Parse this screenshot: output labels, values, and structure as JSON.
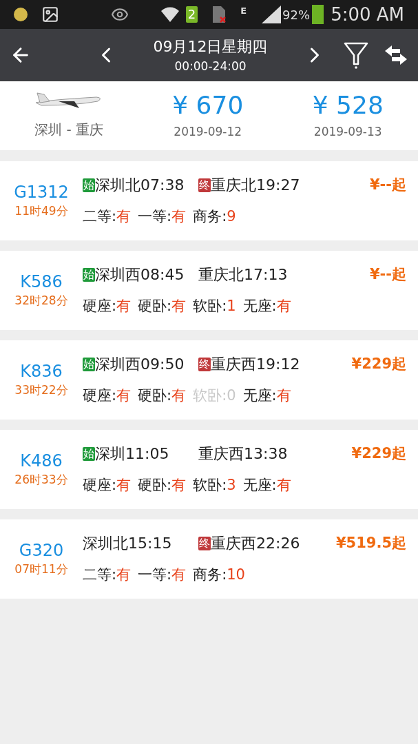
{
  "status_bar": {
    "sim_slot": "2",
    "network_type": "E",
    "battery": "92%",
    "time": "5:00 AM"
  },
  "header": {
    "date": "09月12日星期四",
    "time_range": "00:00-24:00"
  },
  "flight": {
    "route": "深圳 - 重庆",
    "fares": [
      {
        "price": "¥ 670",
        "date": "2019-09-12"
      },
      {
        "price": "¥ 528",
        "date": "2019-09-13"
      }
    ]
  },
  "trains": [
    {
      "number": "G1312",
      "duration": "11时49分",
      "departure": {
        "badge": "始",
        "station": "深圳北07:38"
      },
      "arrival": {
        "badge": "终",
        "station": "重庆北19:27"
      },
      "price": "¥--起",
      "seats": [
        {
          "label": "二等:",
          "value": "有",
          "available": true
        },
        {
          "label": "一等:",
          "value": "有",
          "available": true
        },
        {
          "label": "商务:",
          "value": "9",
          "available": true
        }
      ]
    },
    {
      "number": "K586",
      "duration": "32时28分",
      "departure": {
        "badge": "始",
        "station": "深圳西08:45"
      },
      "arrival": {
        "station": "重庆北17:13"
      },
      "price": "¥--起",
      "seats": [
        {
          "label": "硬座:",
          "value": "有",
          "available": true
        },
        {
          "label": "硬卧:",
          "value": "有",
          "available": true
        },
        {
          "label": "软卧:",
          "value": "1",
          "available": true
        },
        {
          "label": "无座:",
          "value": "有",
          "available": true
        }
      ]
    },
    {
      "number": "K836",
      "duration": "33时22分",
      "departure": {
        "badge": "始",
        "station": "深圳西09:50"
      },
      "arrival": {
        "badge": "终",
        "station": "重庆西19:12"
      },
      "price": "¥229起",
      "seats": [
        {
          "label": "硬座:",
          "value": "有",
          "available": true
        },
        {
          "label": "硬卧:",
          "value": "有",
          "available": true
        },
        {
          "label": "软卧:",
          "value": "0",
          "available": false
        },
        {
          "label": "无座:",
          "value": "有",
          "available": true
        }
      ]
    },
    {
      "number": "K486",
      "duration": "26时33分",
      "departure": {
        "badge": "始",
        "station": "深圳11:05"
      },
      "arrival": {
        "station": "重庆西13:38"
      },
      "price": "¥229起",
      "seats": [
        {
          "label": "硬座:",
          "value": "有",
          "available": true
        },
        {
          "label": "硬卧:",
          "value": "有",
          "available": true
        },
        {
          "label": "软卧:",
          "value": "3",
          "available": true
        },
        {
          "label": "无座:",
          "value": "有",
          "available": true
        }
      ]
    },
    {
      "number": "G320",
      "duration": "07时11分",
      "departure": {
        "station": "深圳北15:15"
      },
      "arrival": {
        "badge": "终",
        "station": "重庆西22:26"
      },
      "price": "¥519.5起",
      "seats": [
        {
          "label": "二等:",
          "value": "有",
          "available": true
        },
        {
          "label": "一等:",
          "value": "有",
          "available": true
        },
        {
          "label": "商务:",
          "value": "10",
          "available": true
        }
      ]
    }
  ]
}
